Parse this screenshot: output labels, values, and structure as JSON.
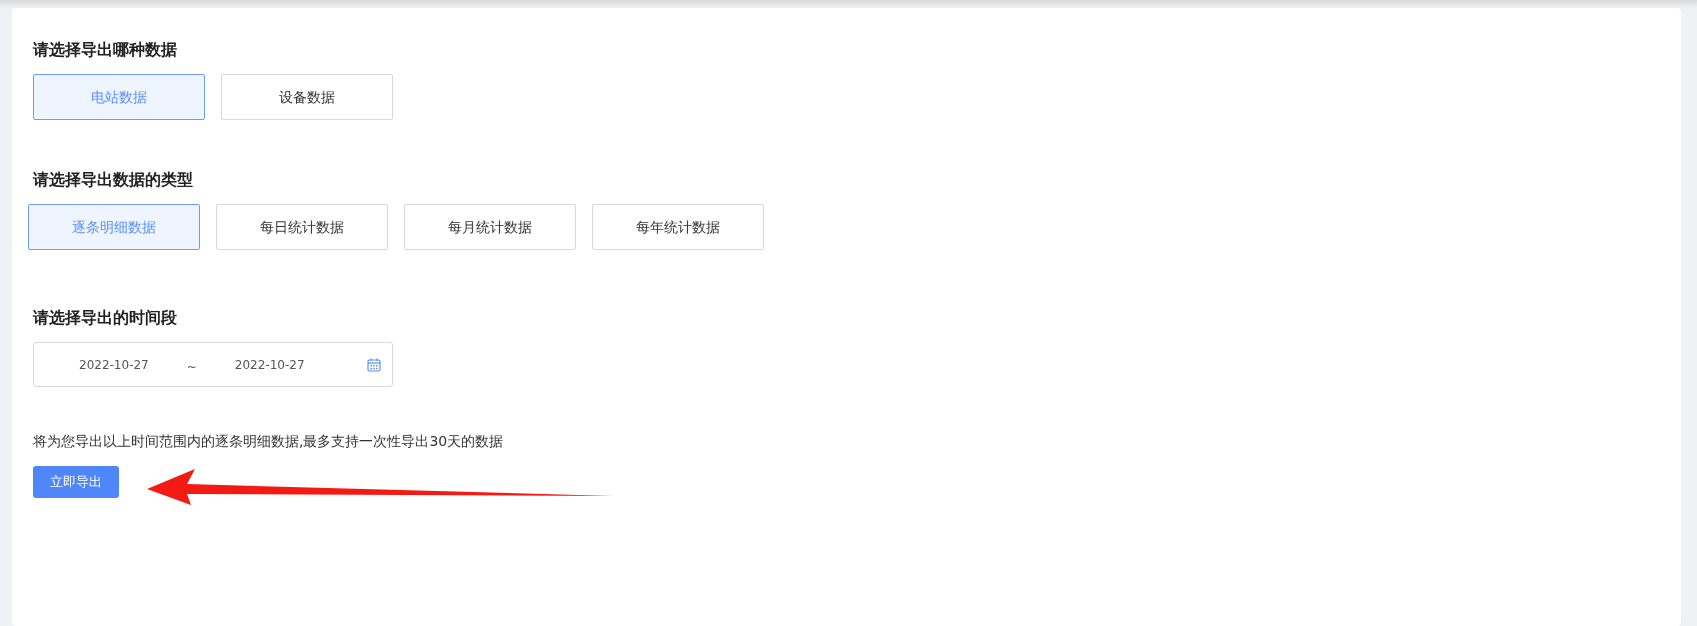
{
  "sections": [
    {
      "title": "请选择导出哪种数据",
      "options": [
        {
          "label": "电站数据",
          "selected": true
        },
        {
          "label": "设备数据",
          "selected": false
        }
      ]
    },
    {
      "title": "请选择导出数据的类型",
      "options": [
        {
          "label": "逐条明细数据",
          "selected": true
        },
        {
          "label": "每日统计数据",
          "selected": false
        },
        {
          "label": "每月统计数据",
          "selected": false
        },
        {
          "label": "每年统计数据",
          "selected": false
        }
      ]
    }
  ],
  "time_section": {
    "title": "请选择导出的时间段",
    "start_date": "2022-10-27",
    "separator": "~",
    "end_date": "2022-10-27"
  },
  "notice": "将为您导出以上时间范围内的逐条明细数据,最多支持一次性导出30天的数据",
  "export_button": "立即导出"
}
